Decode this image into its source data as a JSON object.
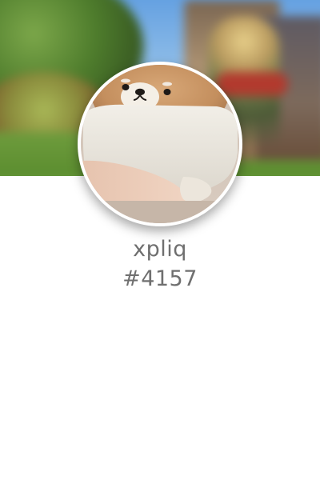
{
  "profile": {
    "username": "xpliq",
    "discriminator": "#4157",
    "avatar_icon": "plush-shiba-avatar",
    "banner_icon": "game-scene-banner"
  },
  "colors": {
    "name_text": "#6f6f6f",
    "background": "#ffffff",
    "ring": "#ffffff"
  }
}
